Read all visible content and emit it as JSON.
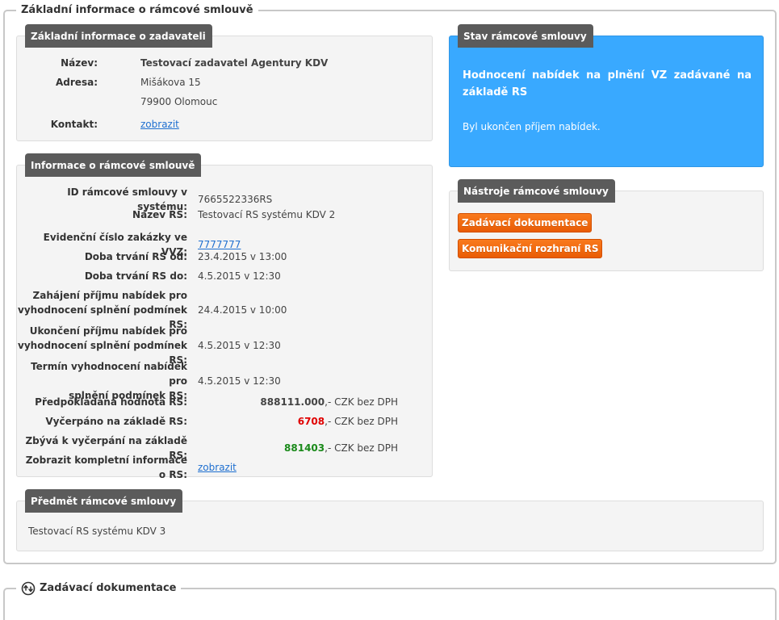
{
  "main_fieldset": {
    "legend": "Základní informace o rámcové smlouvě"
  },
  "zadavatel": {
    "title": "Základní informace o zadavateli",
    "nazev_label": "Název:",
    "nazev_value": "Testovací zadavatel Agentury KDV",
    "adresa_label": "Adresa:",
    "adresa_line1": "Mišákova 15",
    "adresa_line2": "79900 Olomouc",
    "kontakt_label": "Kontakt:",
    "kontakt_link": "zobrazit"
  },
  "info_rs": {
    "title": "Informace o rámcové smlouvě",
    "rows": [
      {
        "label": "ID rámcové smlouvy v systému:",
        "value": "7665522336RS"
      },
      {
        "label": "Název RS:",
        "value": "Testovací RS systému KDV 2"
      },
      {
        "label": "Evidenční číslo zakázky ve VVZ:",
        "value": "7777777"
      },
      {
        "label": "Doba trvání RS od:",
        "value": "23.4.2015 v 13:00"
      },
      {
        "label": "Doba trvání RS do:",
        "value": "4.5.2015 v 12:30"
      },
      {
        "label_line1": "Zahájení příjmu nabídek pro",
        "label_line2": "vyhodnocení splnění podmínek RS:",
        "value": "24.4.2015 v 10:00"
      },
      {
        "label_line1": "Ukončení příjmu nabídek pro",
        "label_line2": "vyhodnocení splnění podmínek RS:",
        "value": "4.5.2015 v 12:30"
      },
      {
        "label_line1": "Termín vyhodnocení nabídek pro",
        "label_line2": "splnění podmínek RS:",
        "value": "4.5.2015 v 12:30"
      }
    ],
    "predpokladana_label": "Předpokládaná hodnota RS:",
    "predpokladana_amount": "888111.000",
    "vycerpano_label": "Vyčerpáno na základě RS:",
    "vycerpano_amount": "6708",
    "zbyva_label": "Zbývá k vyčerpání na základě RS:",
    "zbyva_amount": "881403",
    "currency_suffix": ",- CZK bez DPH",
    "kompletni_label": "Zobrazit kompletní informace o RS:",
    "kompletni_link": "zobrazit"
  },
  "stav": {
    "title": "Stav rámcové smlouvy",
    "heading": "Hodnocení nabídek na plnění VZ zadávané na základě RS",
    "text": "Byl ukončen příjem nabídek."
  },
  "nastroje": {
    "title": "Nástroje rámcové smlouvy",
    "btn_zadavaci": "Zadávací dokumentace",
    "btn_komunikacni": "Komunikační rozhraní RS"
  },
  "predmet": {
    "title": "Předmět rámcové smlouvy",
    "text": "Testovací RS systému KDV 3"
  },
  "zadavaci_fieldset": {
    "legend": "Zadávací dokumentace",
    "icon": "toggle-arrows-icon"
  },
  "colors": {
    "label_bg": "#5b5b5b",
    "status_bg": "#39a9ff",
    "button_orange": "#f06a10",
    "link": "#1e6fd0",
    "red": "#e00000",
    "green": "#1a8a1a"
  }
}
